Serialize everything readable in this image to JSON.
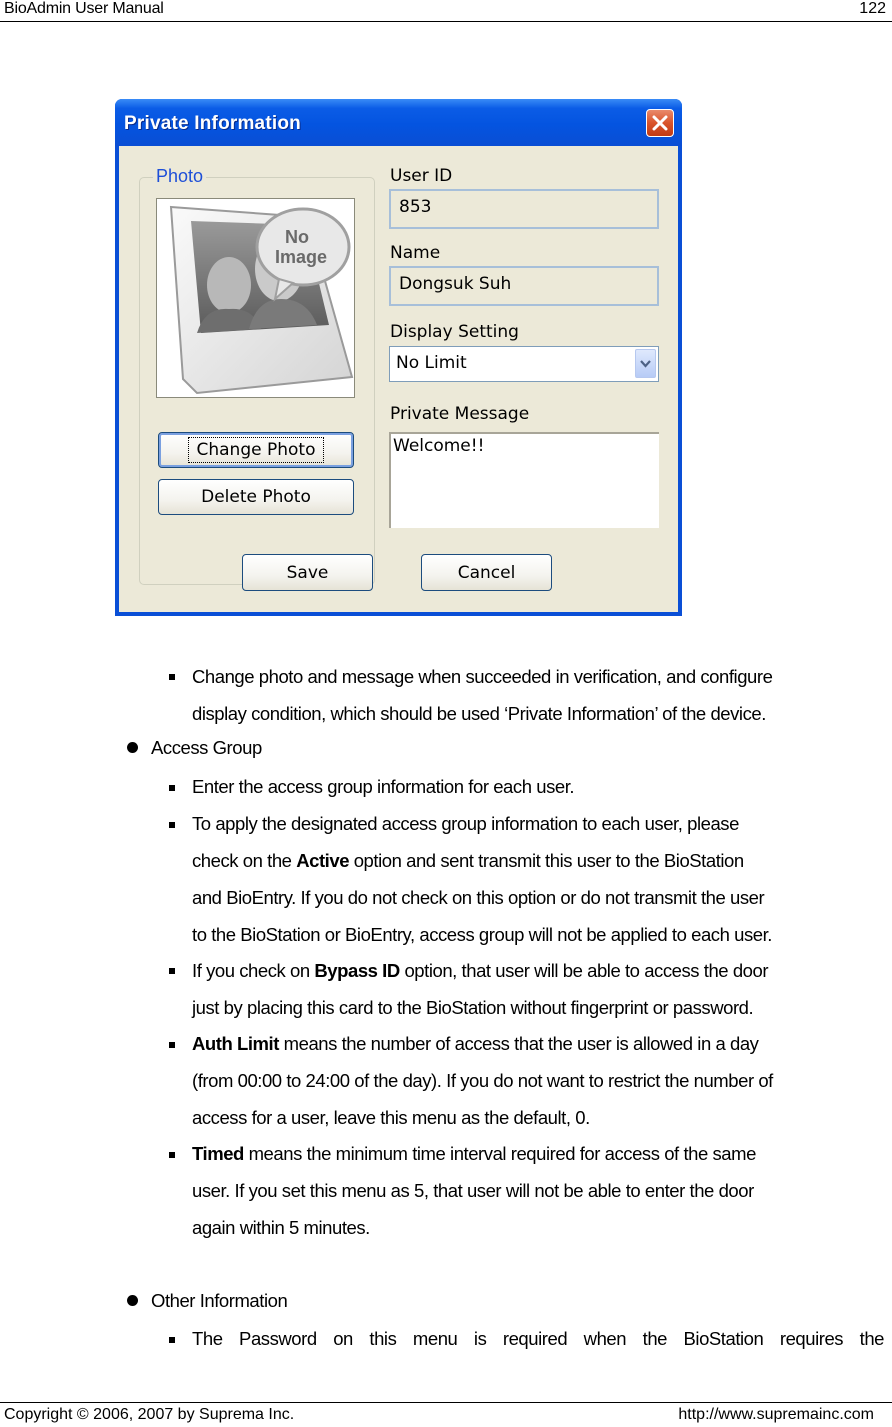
{
  "page": {
    "header_title": "BioAdmin  User  Manual",
    "page_number": "122",
    "footer_copyright": "Copyright © 2006, 2007 by Suprema Inc.",
    "footer_url": "http://www.supremainc.com"
  },
  "dialog": {
    "title": "Private Information",
    "close_icon": "close-x-icon",
    "photo_group_label": "Photo",
    "photo_placeholder": {
      "line1": "No",
      "line2": "Image"
    },
    "change_photo_label": "Change Photo",
    "delete_photo_label": "Delete Photo",
    "user_id_label": "User ID",
    "user_id_value": "853",
    "name_label": "Name",
    "name_value": "Dongsuk Suh",
    "display_setting_label": "Display Setting",
    "display_setting_value": "No Limit",
    "private_message_label": "Private Message",
    "private_message_value": "Welcome!!",
    "save_label": "Save",
    "cancel_label": "Cancel"
  },
  "content": {
    "private_info_desc": {
      "line1": "Change photo and message when succeeded in verification, and configure",
      "line2": "display condition, which should be used ‘Private Information’ of the device."
    },
    "access_group": {
      "heading": "Access Group",
      "item1": "Enter the access group information for each user.",
      "item2": {
        "line1": "To apply the designated access group information to each user, please",
        "line2_pre": "check on the ",
        "line2_bold": "Active",
        "line2_post": " option and sent transmit this user to the BioStation",
        "line3": "and BioEntry. If you do not check on this option or do not transmit the user",
        "line4": "to the BioStation or BioEntry, access group will not be applied to each user."
      },
      "item3": {
        "line1_pre": "If you check on ",
        "line1_bold": "Bypass ID",
        "line1_post": " option, that user will be able to access the door",
        "line2": "just by placing this card to the BioStation without fingerprint or password."
      },
      "item4": {
        "line1_bold": "Auth Limit",
        "line1_post": " means the number of access that the user is allowed in a day",
        "line2": "(from 00:00 to 24:00 of the day). If you do not want to restrict the number of",
        "line3": "access for a user, leave this menu as the default, 0."
      },
      "item5": {
        "line1_bold": "Timed",
        "line1_post": " means the minimum time interval required for access of the same",
        "line2": "user. If you set this menu as 5, that user will not be able to enter the door",
        "line3": "again within 5 minutes."
      }
    },
    "other_information": {
      "heading": "Other Information",
      "item1": "The Password on this menu is required when the BioStation requires the"
    }
  }
}
